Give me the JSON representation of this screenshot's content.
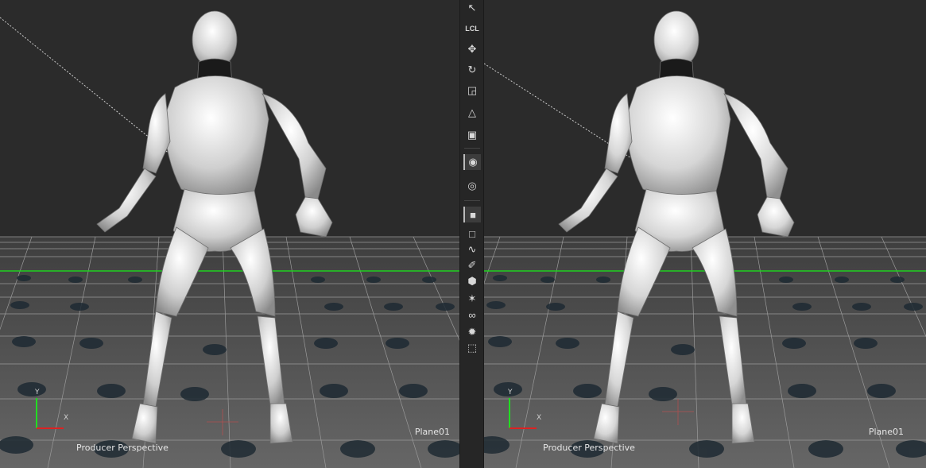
{
  "viewports": [
    {
      "camera_label": "Producer Perspective",
      "object_label": "Plane01",
      "axis_y": "Y",
      "axis_x": "X"
    },
    {
      "camera_label": "Producer Perspective",
      "object_label": "Plane01",
      "axis_y": "Y",
      "axis_x": "X"
    }
  ],
  "toolbar": {
    "local_label": "LCL",
    "tools": [
      "select-arrow-icon",
      "local-coordinates-icon",
      "move-icon",
      "rotate-icon",
      "scale-icon",
      "ik-icon",
      "pivot-icon",
      "render-preview-icon",
      "render-settings-icon",
      "solid-shading-icon",
      "flat-shading-icon",
      "wireframe-icon",
      "brush-icon",
      "hexagon-icon",
      "joint-icon",
      "constraint-icon",
      "light-icon",
      "frame-icon"
    ]
  },
  "colors": {
    "background": "#2b2b2b",
    "ground": "#5b5b5b",
    "grid": "#9a9a9a",
    "horizon": "#1fd21f",
    "figure": "#d9d9d9"
  }
}
